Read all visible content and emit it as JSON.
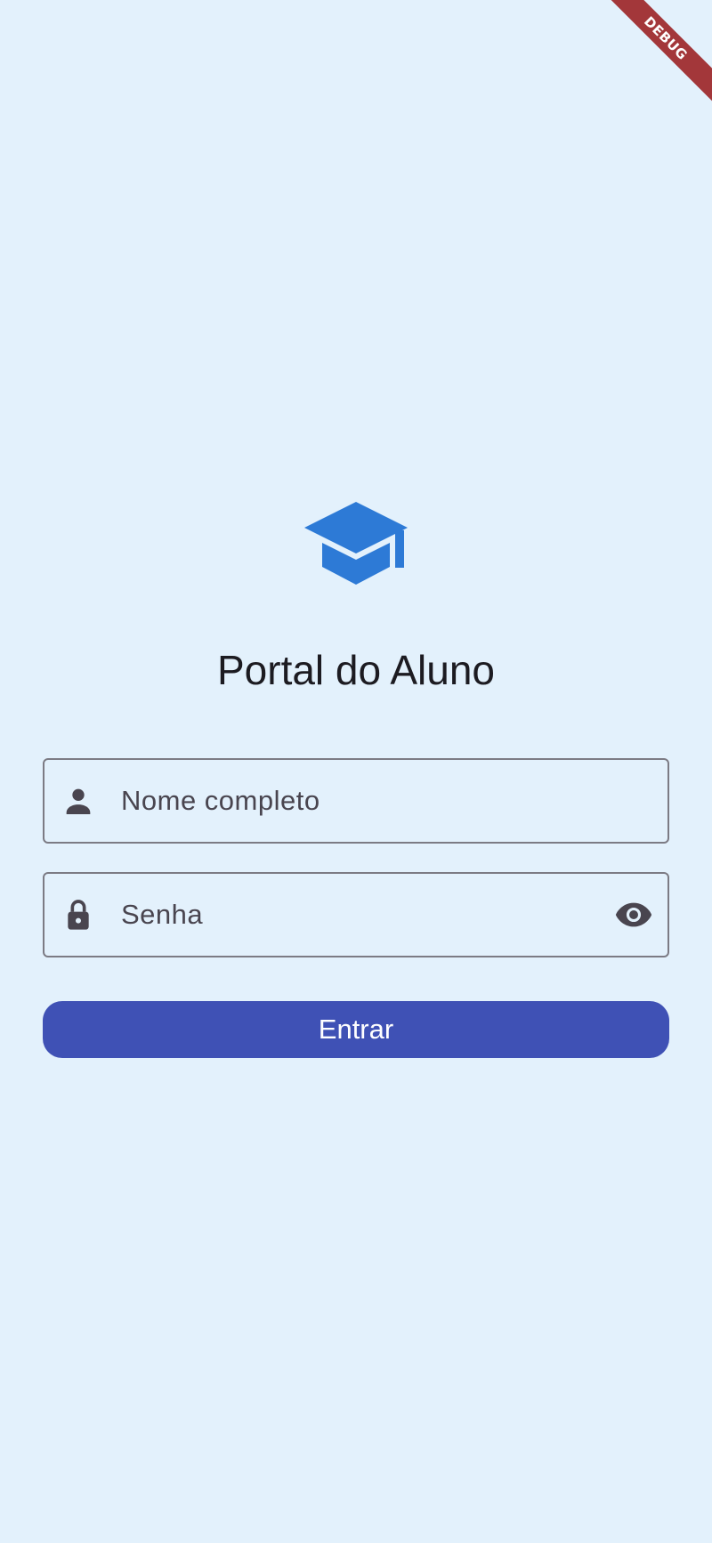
{
  "app": {
    "debug_label": "DEBUG",
    "title": "Portal do Aluno"
  },
  "logo": {
    "icon": "graduation-cap-icon",
    "color": "#2d7ad6"
  },
  "form": {
    "name_field": {
      "placeholder": "Nome completo",
      "value": "",
      "icon": "person-icon"
    },
    "password_field": {
      "placeholder": "Senha",
      "value": "",
      "icon": "lock-icon",
      "toggle_icon": "eye-icon"
    },
    "submit_label": "Entrar"
  },
  "colors": {
    "background": "#e3f1fc",
    "primary_button": "#3f51b5",
    "debug_banner": "#a3373a",
    "icon": "#49454f"
  }
}
